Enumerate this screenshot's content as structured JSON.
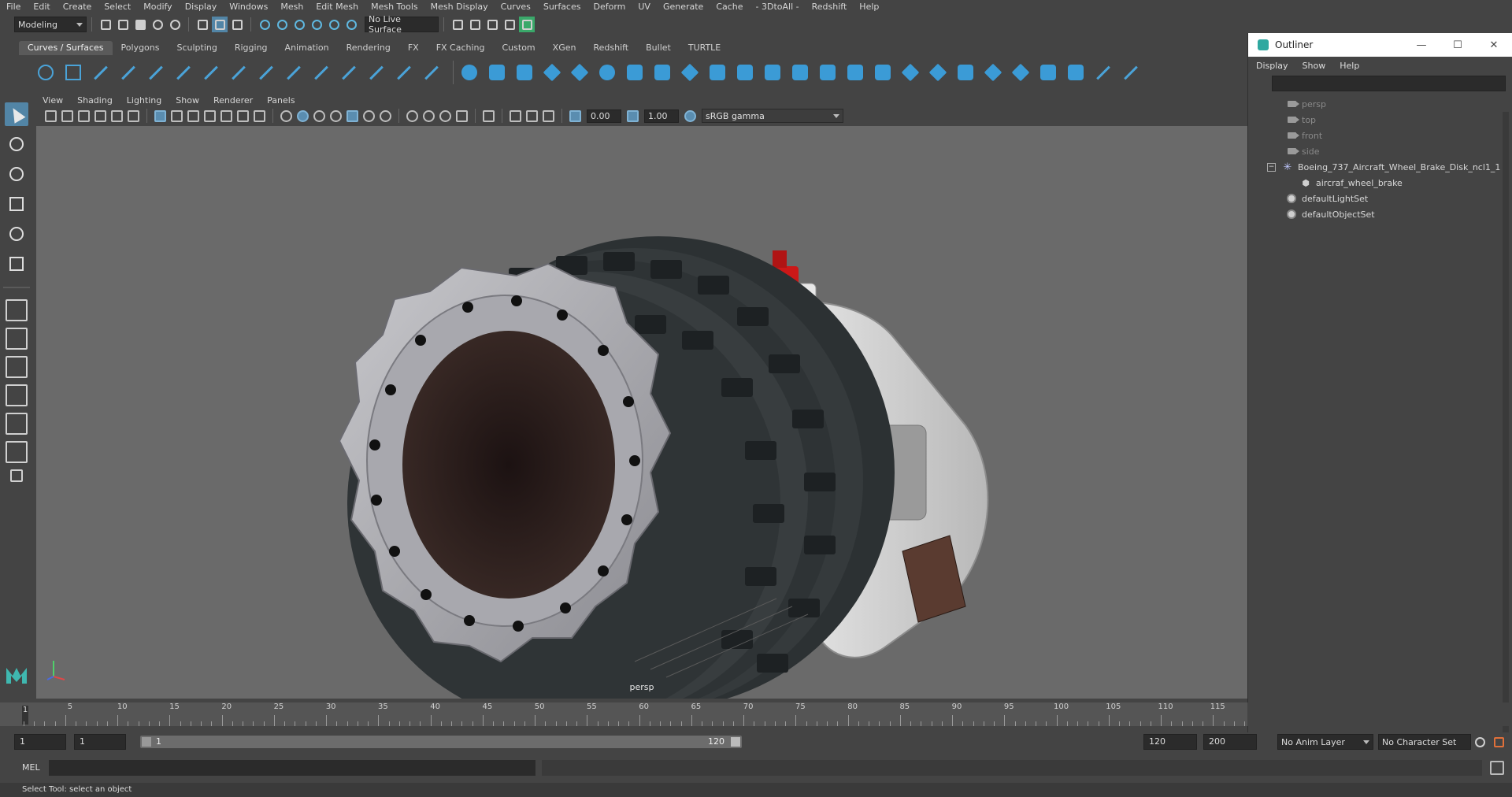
{
  "menubar": {
    "items": [
      "File",
      "Edit",
      "Create",
      "Select",
      "Modify",
      "Display",
      "Windows",
      "Mesh",
      "Edit Mesh",
      "Mesh Tools",
      "Mesh Display",
      "Curves",
      "Surfaces",
      "Deform",
      "UV",
      "Generate",
      "Cache",
      "- 3DtoAll -",
      "Redshift",
      "Help"
    ]
  },
  "statusline": {
    "workspace": "Modeling",
    "live_surface": "No Live Surface"
  },
  "shelf": {
    "tabs": [
      "Curves / Surfaces",
      "Polygons",
      "Sculpting",
      "Rigging",
      "Animation",
      "Rendering",
      "FX",
      "FX Caching",
      "Custom",
      "XGen",
      "Redshift",
      "Bullet",
      "TURTLE"
    ],
    "active_tab": "Curves / Surfaces"
  },
  "viewport": {
    "menu": [
      "View",
      "Shading",
      "Lighting",
      "Show",
      "Renderer",
      "Panels"
    ],
    "exposure": "0.00",
    "gamma": "1.00",
    "color_space": "sRGB gamma",
    "camera_label": "persp"
  },
  "outliner": {
    "title": "Outliner",
    "menu": [
      "Display",
      "Show",
      "Help"
    ],
    "items": [
      {
        "label": "persp",
        "kind": "camera",
        "dim": true
      },
      {
        "label": "top",
        "kind": "camera",
        "dim": true
      },
      {
        "label": "front",
        "kind": "camera",
        "dim": true
      },
      {
        "label": "side",
        "kind": "camera",
        "dim": true
      },
      {
        "label": "Boeing_737_Aircraft_Wheel_Brake_Disk_ncl1_1",
        "kind": "group",
        "dim": false
      },
      {
        "label": "aircraf_wheel_brake",
        "kind": "mesh",
        "dim": false
      },
      {
        "label": "defaultLightSet",
        "kind": "set",
        "dim": false
      },
      {
        "label": "defaultObjectSet",
        "kind": "set",
        "dim": false
      }
    ],
    "window_controls": [
      "—",
      "☐",
      "✕"
    ]
  },
  "timeline": {
    "tick_labels": [
      "5",
      "10",
      "15",
      "20",
      "25",
      "30",
      "35",
      "40",
      "45",
      "50",
      "55",
      "60",
      "65",
      "70",
      "75",
      "80",
      "85",
      "90",
      "95",
      "100",
      "105",
      "110",
      "115"
    ],
    "current_frame": "1"
  },
  "range": {
    "start_field": "1",
    "start2_field": "1",
    "slider_start": "1",
    "slider_end": "120",
    "end_field": "120",
    "end2_field": "200",
    "anim_layer": "No Anim Layer",
    "character_set": "No Character Set"
  },
  "command": {
    "language": "MEL"
  },
  "helpline": {
    "text": "Select Tool: select an object"
  },
  "colors": {
    "accent": "#4aa3d8",
    "selected_tool": "#5285a6",
    "viewport_bg": "#6a6a6a"
  }
}
